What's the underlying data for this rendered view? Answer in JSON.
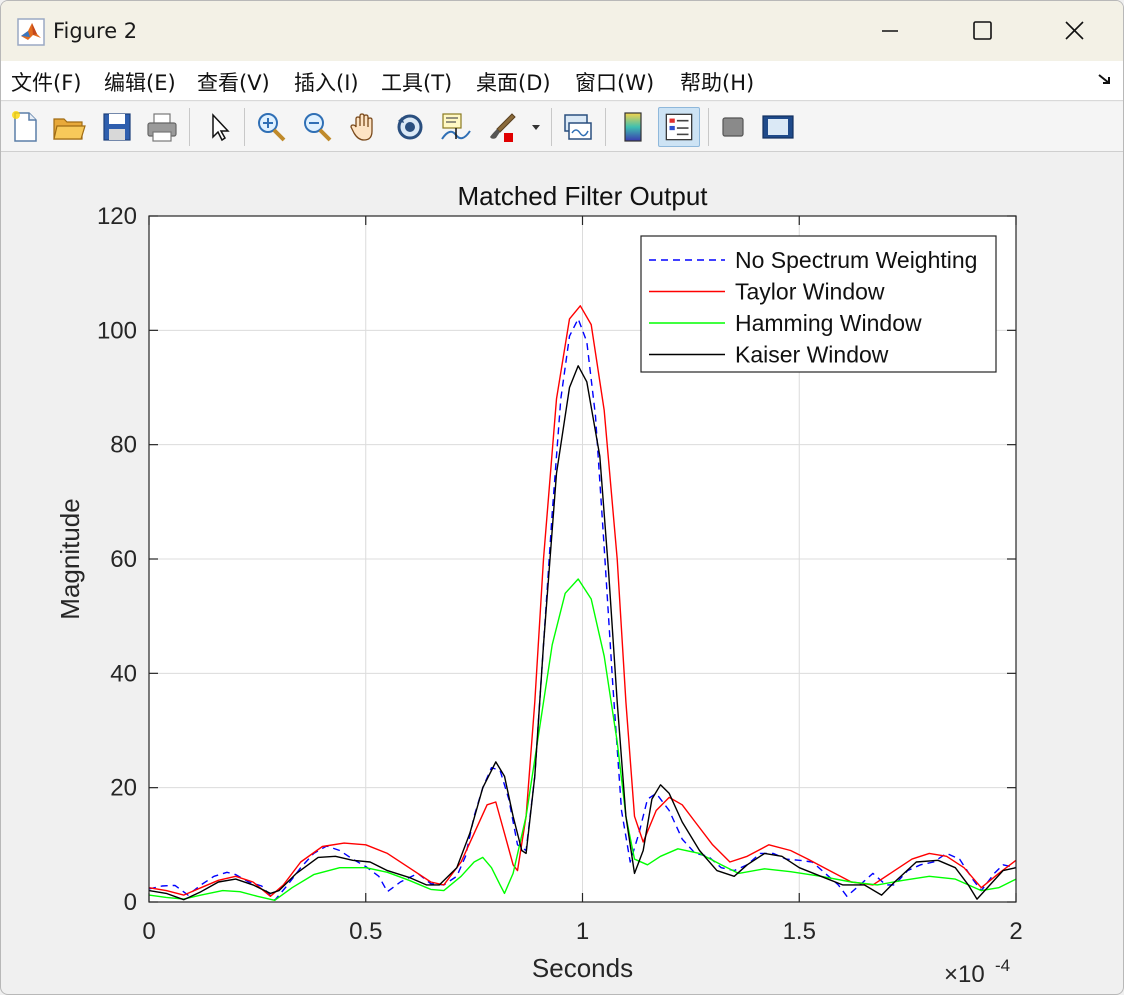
{
  "window": {
    "title": "Figure 2"
  },
  "menu": {
    "items": [
      "文件(F)",
      "编辑(E)",
      "查看(V)",
      "插入(I)",
      "工具(T)",
      "桌面(D)",
      "窗口(W)",
      "帮助(H)"
    ]
  },
  "toolbar": {
    "icons": [
      "new-figure-icon",
      "open-file-icon",
      "save-icon",
      "print-icon",
      "pointer-icon",
      "zoom-in-icon",
      "zoom-out-icon",
      "pan-icon",
      "rotate-3d-icon",
      "data-cursor-icon",
      "brush-icon",
      "link-plot-icon",
      "colorbar-icon",
      "legend-icon",
      "hide-plot-tools-icon",
      "show-plot-tools-icon"
    ]
  },
  "colors": {
    "no_weighting": "#0000ff",
    "taylor": "#ff0000",
    "hamming": "#00ff00",
    "kaiser": "#000000",
    "grid": "#dcdcdc",
    "axes_bg": "#ffffff",
    "figure_bg": "#f0f0f0"
  },
  "chart_data": {
    "type": "line",
    "title": "Matched Filter Output",
    "xlabel": "Seconds",
    "ylabel": "Magnitude",
    "x_exponent_label": "×10",
    "x_exponent_power": "-4",
    "xlim": [
      0,
      2
    ],
    "ylim": [
      0,
      120
    ],
    "xticks": [
      0,
      0.5,
      1,
      1.5,
      2
    ],
    "xtick_labels": [
      "0",
      "0.5",
      "1",
      "1.5",
      "2"
    ],
    "yticks": [
      0,
      20,
      40,
      60,
      80,
      100,
      120
    ],
    "ytick_labels": [
      "0",
      "20",
      "40",
      "60",
      "80",
      "100",
      "120"
    ],
    "grid": true,
    "legend_position": "top-right",
    "series": [
      {
        "name": "No Spectrum Weighting",
        "style": "dashed",
        "points": [
          [
            0,
            2.3
          ],
          [
            0.03,
            2.8
          ],
          [
            0.06,
            2.9
          ],
          [
            0.09,
            1.2
          ],
          [
            0.12,
            3.0
          ],
          [
            0.15,
            4.5
          ],
          [
            0.18,
            5.2
          ],
          [
            0.2,
            4.8
          ],
          [
            0.23,
            3.5
          ],
          [
            0.26,
            2.8
          ],
          [
            0.29,
            0.3
          ],
          [
            0.32,
            3.0
          ],
          [
            0.35,
            6.0
          ],
          [
            0.38,
            8.5
          ],
          [
            0.41,
            9.8
          ],
          [
            0.44,
            9.0
          ],
          [
            0.47,
            7.5
          ],
          [
            0.5,
            6.2
          ],
          [
            0.53,
            4.5
          ],
          [
            0.55,
            1.8
          ],
          [
            0.58,
            3.5
          ],
          [
            0.62,
            5.0
          ],
          [
            0.65,
            3.2
          ],
          [
            0.68,
            3.0
          ],
          [
            0.71,
            4.5
          ],
          [
            0.73,
            8.0
          ],
          [
            0.75,
            15.0
          ],
          [
            0.77,
            20.0
          ],
          [
            0.79,
            23.5
          ],
          [
            0.81,
            23.0
          ],
          [
            0.83,
            18.0
          ],
          [
            0.85,
            10.0
          ],
          [
            0.87,
            9.0
          ],
          [
            0.89,
            22.0
          ],
          [
            0.91,
            45.0
          ],
          [
            0.93,
            68.0
          ],
          [
            0.95,
            88.0
          ],
          [
            0.97,
            99.0
          ],
          [
            0.99,
            102.0
          ],
          [
            1.01,
            98.0
          ],
          [
            1.03,
            85.0
          ],
          [
            1.05,
            62.0
          ],
          [
            1.07,
            38.0
          ],
          [
            1.09,
            16.0
          ],
          [
            1.11,
            7.0
          ],
          [
            1.13,
            12.0
          ],
          [
            1.15,
            18.0
          ],
          [
            1.17,
            19.0
          ],
          [
            1.2,
            16.0
          ],
          [
            1.23,
            11.0
          ],
          [
            1.26,
            8.5
          ],
          [
            1.29,
            8.0
          ],
          [
            1.32,
            6.0
          ],
          [
            1.35,
            5.5
          ],
          [
            1.38,
            6.5
          ],
          [
            1.41,
            8.5
          ],
          [
            1.44,
            8.5
          ],
          [
            1.47,
            7.5
          ],
          [
            1.5,
            7.3
          ],
          [
            1.53,
            7.0
          ],
          [
            1.56,
            5.0
          ],
          [
            1.59,
            3.0
          ],
          [
            1.61,
            1.0
          ],
          [
            1.64,
            3.0
          ],
          [
            1.67,
            5.0
          ],
          [
            1.7,
            3.0
          ],
          [
            1.72,
            3.0
          ],
          [
            1.75,
            5.5
          ],
          [
            1.78,
            6.5
          ],
          [
            1.81,
            7.0
          ],
          [
            1.84,
            8.5
          ],
          [
            1.87,
            7.5
          ],
          [
            1.9,
            4.0
          ],
          [
            1.92,
            2.0
          ],
          [
            1.95,
            5.0
          ],
          [
            1.97,
            6.5
          ],
          [
            2.0,
            6.0
          ]
        ]
      },
      {
        "name": "Taylor Window",
        "style": "solid",
        "points": [
          [
            0,
            2.5
          ],
          [
            0.04,
            2.0
          ],
          [
            0.08,
            1.2
          ],
          [
            0.12,
            2.5
          ],
          [
            0.16,
            3.8
          ],
          [
            0.2,
            4.5
          ],
          [
            0.24,
            3.5
          ],
          [
            0.28,
            1.0
          ],
          [
            0.31,
            3.0
          ],
          [
            0.35,
            7.0
          ],
          [
            0.4,
            9.7
          ],
          [
            0.45,
            10.3
          ],
          [
            0.5,
            10.0
          ],
          [
            0.55,
            8.5
          ],
          [
            0.6,
            6.0
          ],
          [
            0.65,
            3.5
          ],
          [
            0.68,
            3.0
          ],
          [
            0.72,
            7.0
          ],
          [
            0.75,
            12.0
          ],
          [
            0.78,
            17.0
          ],
          [
            0.8,
            17.5
          ],
          [
            0.82,
            12.0
          ],
          [
            0.84,
            6.5
          ],
          [
            0.85,
            5.5
          ],
          [
            0.87,
            15.0
          ],
          [
            0.89,
            35.0
          ],
          [
            0.91,
            60.0
          ],
          [
            0.94,
            88.0
          ],
          [
            0.97,
            102.0
          ],
          [
            0.995,
            104.3
          ],
          [
            1.02,
            101.0
          ],
          [
            1.05,
            86.0
          ],
          [
            1.08,
            60.0
          ],
          [
            1.1,
            35.0
          ],
          [
            1.12,
            15.0
          ],
          [
            1.14,
            10.5
          ],
          [
            1.17,
            16.0
          ],
          [
            1.2,
            18.3
          ],
          [
            1.23,
            17.0
          ],
          [
            1.26,
            14.0
          ],
          [
            1.3,
            10.0
          ],
          [
            1.34,
            7.0
          ],
          [
            1.38,
            8.0
          ],
          [
            1.43,
            10.0
          ],
          [
            1.48,
            9.0
          ],
          [
            1.52,
            7.5
          ],
          [
            1.57,
            5.5
          ],
          [
            1.62,
            3.5
          ],
          [
            1.67,
            3.0
          ],
          [
            1.72,
            5.5
          ],
          [
            1.76,
            7.5
          ],
          [
            1.8,
            8.5
          ],
          [
            1.84,
            8.0
          ],
          [
            1.88,
            6.0
          ],
          [
            1.92,
            2.5
          ],
          [
            1.96,
            5.0
          ],
          [
            2.0,
            7.3
          ]
        ]
      },
      {
        "name": "Hamming Window",
        "style": "solid",
        "points": [
          [
            0,
            1.2
          ],
          [
            0.04,
            0.8
          ],
          [
            0.08,
            0.5
          ],
          [
            0.12,
            1.2
          ],
          [
            0.17,
            2.0
          ],
          [
            0.21,
            1.8
          ],
          [
            0.25,
            1.0
          ],
          [
            0.29,
            0.3
          ],
          [
            0.33,
            2.5
          ],
          [
            0.38,
            4.8
          ],
          [
            0.44,
            6.0
          ],
          [
            0.5,
            6.0
          ],
          [
            0.55,
            5.2
          ],
          [
            0.6,
            3.8
          ],
          [
            0.65,
            2.2
          ],
          [
            0.68,
            2.0
          ],
          [
            0.72,
            4.5
          ],
          [
            0.75,
            7.0
          ],
          [
            0.77,
            7.8
          ],
          [
            0.79,
            6.0
          ],
          [
            0.81,
            3.0
          ],
          [
            0.82,
            1.5
          ],
          [
            0.84,
            5.0
          ],
          [
            0.87,
            15.0
          ],
          [
            0.9,
            30.0
          ],
          [
            0.93,
            45.0
          ],
          [
            0.96,
            54.0
          ],
          [
            0.99,
            56.5
          ],
          [
            1.02,
            53.0
          ],
          [
            1.05,
            43.0
          ],
          [
            1.08,
            28.0
          ],
          [
            1.1,
            15.0
          ],
          [
            1.12,
            7.5
          ],
          [
            1.15,
            6.5
          ],
          [
            1.18,
            8.0
          ],
          [
            1.22,
            9.3
          ],
          [
            1.27,
            8.5
          ],
          [
            1.32,
            6.5
          ],
          [
            1.36,
            5.0
          ],
          [
            1.42,
            5.8
          ],
          [
            1.48,
            5.3
          ],
          [
            1.55,
            4.5
          ],
          [
            1.62,
            3.5
          ],
          [
            1.68,
            3.0
          ],
          [
            1.74,
            3.8
          ],
          [
            1.8,
            4.5
          ],
          [
            1.86,
            4.0
          ],
          [
            1.92,
            2.0
          ],
          [
            1.96,
            2.5
          ],
          [
            2.0,
            4.0
          ]
        ]
      },
      {
        "name": "Kaiser Window",
        "style": "solid",
        "points": [
          [
            0,
            2.0
          ],
          [
            0.04,
            1.5
          ],
          [
            0.08,
            0.4
          ],
          [
            0.12,
            1.8
          ],
          [
            0.16,
            3.5
          ],
          [
            0.2,
            4.0
          ],
          [
            0.24,
            3.0
          ],
          [
            0.28,
            1.5
          ],
          [
            0.3,
            2.0
          ],
          [
            0.34,
            5.0
          ],
          [
            0.39,
            7.8
          ],
          [
            0.43,
            8.0
          ],
          [
            0.47,
            7.3
          ],
          [
            0.51,
            7.0
          ],
          [
            0.55,
            5.5
          ],
          [
            0.6,
            4.3
          ],
          [
            0.64,
            3.0
          ],
          [
            0.67,
            3.0
          ],
          [
            0.71,
            6.0
          ],
          [
            0.74,
            12.0
          ],
          [
            0.77,
            20.0
          ],
          [
            0.8,
            24.5
          ],
          [
            0.82,
            22.0
          ],
          [
            0.84,
            15.0
          ],
          [
            0.86,
            9.0
          ],
          [
            0.87,
            8.5
          ],
          [
            0.89,
            22.0
          ],
          [
            0.91,
            45.0
          ],
          [
            0.94,
            75.0
          ],
          [
            0.97,
            90.0
          ],
          [
            0.99,
            93.8
          ],
          [
            1.01,
            91.0
          ],
          [
            1.04,
            78.0
          ],
          [
            1.06,
            58.0
          ],
          [
            1.08,
            35.0
          ],
          [
            1.1,
            15.0
          ],
          [
            1.12,
            5.0
          ],
          [
            1.14,
            9.0
          ],
          [
            1.16,
            18.0
          ],
          [
            1.18,
            20.5
          ],
          [
            1.2,
            19.0
          ],
          [
            1.23,
            14.0
          ],
          [
            1.27,
            9.0
          ],
          [
            1.31,
            5.5
          ],
          [
            1.35,
            4.5
          ],
          [
            1.38,
            6.5
          ],
          [
            1.42,
            8.5
          ],
          [
            1.46,
            8.0
          ],
          [
            1.5,
            6.0
          ],
          [
            1.55,
            4.5
          ],
          [
            1.6,
            3.0
          ],
          [
            1.65,
            3.0
          ],
          [
            1.69,
            1.2
          ],
          [
            1.72,
            3.5
          ],
          [
            1.77,
            7.0
          ],
          [
            1.82,
            7.3
          ],
          [
            1.86,
            6.0
          ],
          [
            1.89,
            3.0
          ],
          [
            1.91,
            0.5
          ],
          [
            1.94,
            3.0
          ],
          [
            1.97,
            5.5
          ],
          [
            2.0,
            6.0
          ]
        ]
      }
    ]
  }
}
